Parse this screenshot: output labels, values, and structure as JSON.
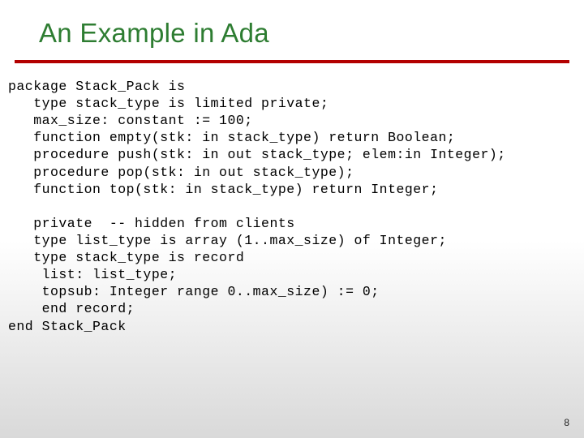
{
  "title": "An Example in Ada",
  "code": {
    "l1": "package Stack_Pack is",
    "l2": "   type stack_type is limited private;",
    "l3": "   max_size: constant := 100;",
    "l4": "   function empty(stk: in stack_type) return Boolean;",
    "l5": "   procedure push(stk: in out stack_type; elem:in Integer);",
    "l6": "   procedure pop(stk: in out stack_type);",
    "l7": "   function top(stk: in stack_type) return Integer;",
    "l8": "",
    "l9": "   private  -- hidden from clients",
    "l10": "   type list_type is array (1..max_size) of Integer;",
    "l11": "   type stack_type is record",
    "l12": "    list: list_type;",
    "l13": "    topsub: Integer range 0..max_size) := 0;",
    "l14": "    end record;",
    "l15": "end Stack_Pack"
  },
  "page_number": "8"
}
